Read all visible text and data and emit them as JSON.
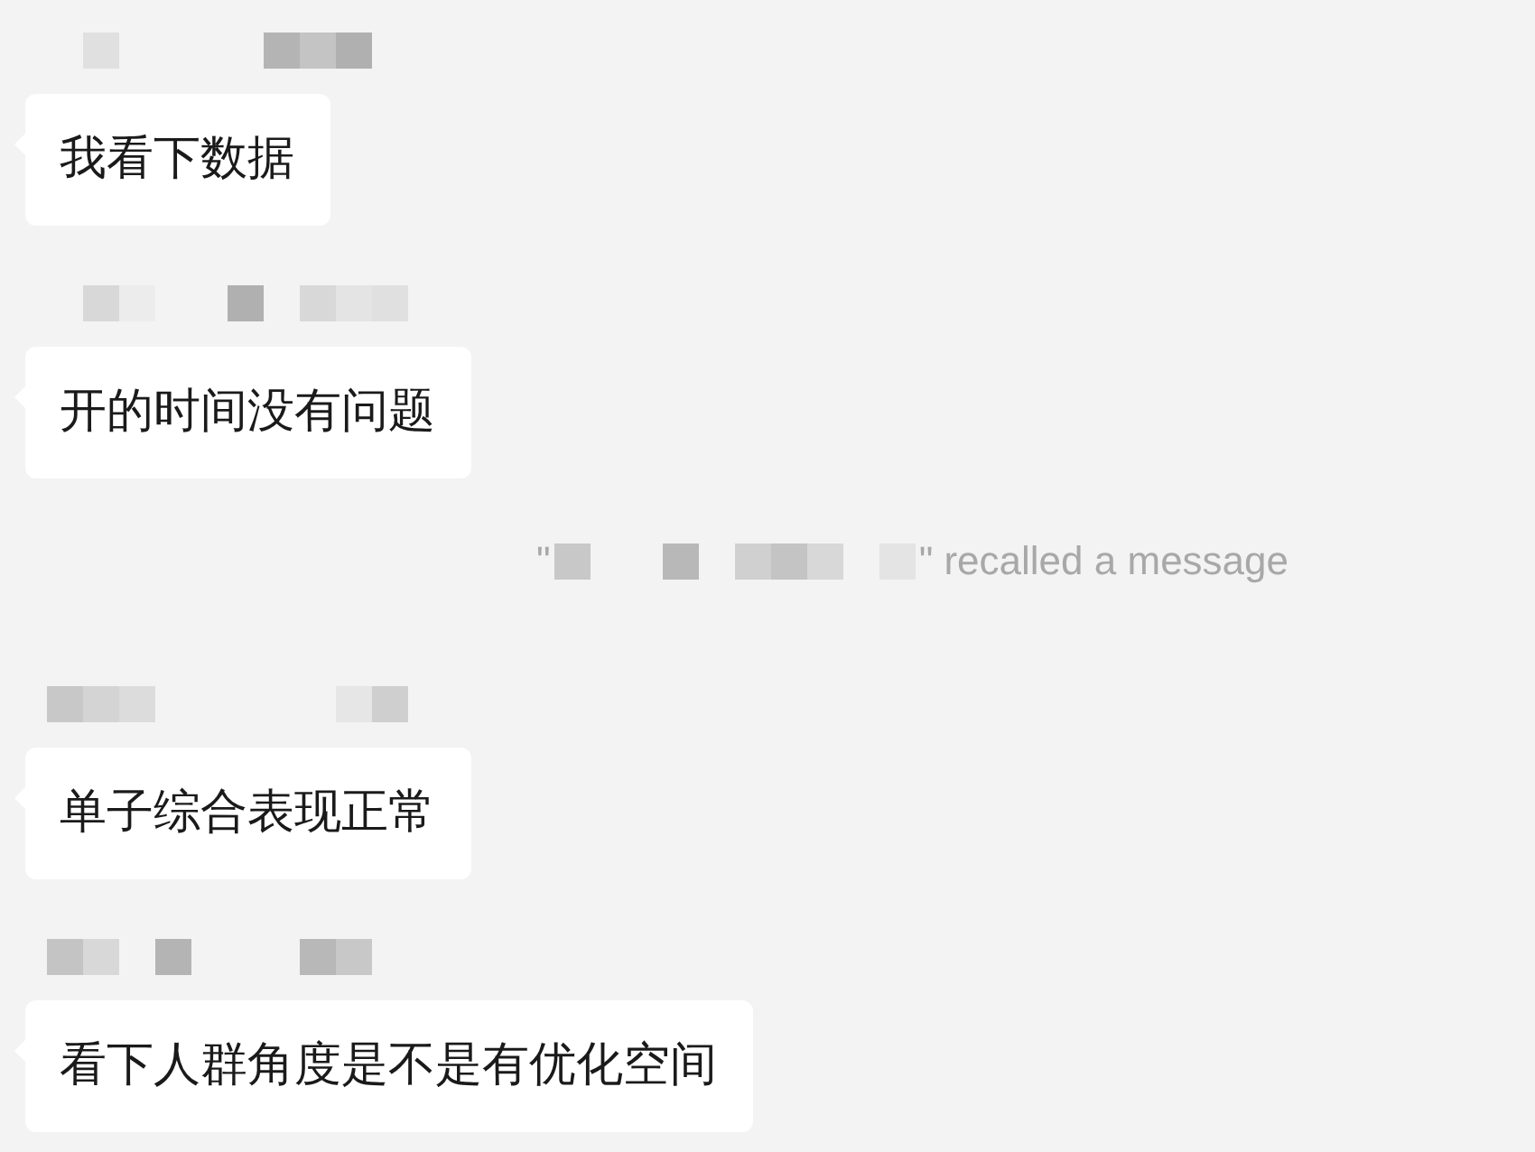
{
  "messages": [
    {
      "kind": "bubble",
      "text": "我看下数据"
    },
    {
      "kind": "bubble",
      "text": "开的时间没有问题"
    },
    {
      "kind": "recall",
      "prefix": "\"",
      "suffix": "\" recalled a message"
    },
    {
      "kind": "bubble",
      "text": "单子综合表现正常"
    },
    {
      "kind": "bubble",
      "text": "看下人群角度是不是有优化空间"
    }
  ]
}
